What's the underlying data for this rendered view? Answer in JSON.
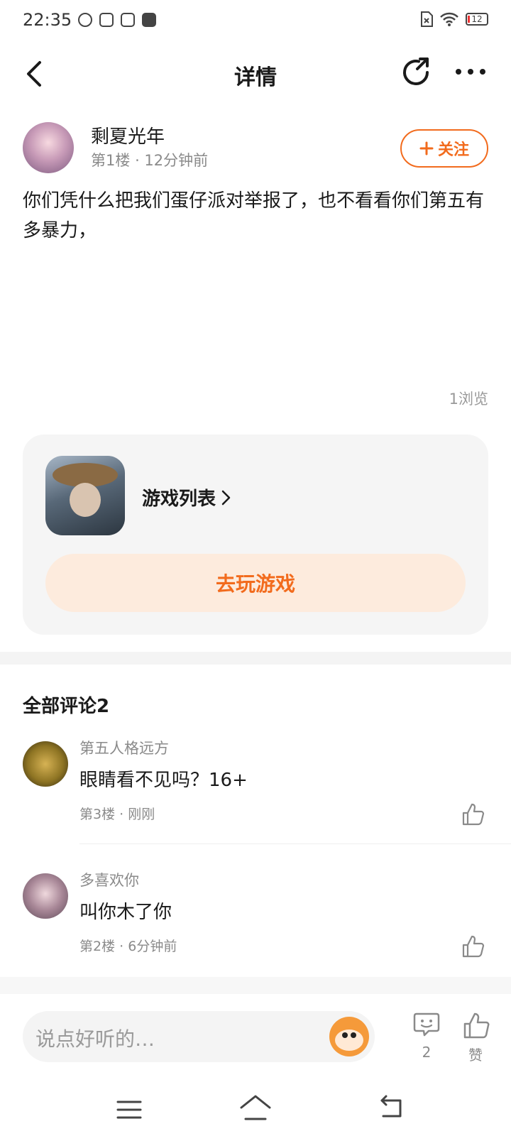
{
  "status_bar": {
    "time": "22:35",
    "battery": "12"
  },
  "header": {
    "title": "详情"
  },
  "post": {
    "author": "剩夏光年",
    "floor": "第1楼",
    "time": "12分钟前",
    "follow_label": "关注",
    "text": "你们凭什么把我们蛋仔派对举报了，也不看看你们第五有多暴力，",
    "views": "1浏览"
  },
  "game_card": {
    "list_label": "游戏列表",
    "play_label": "去玩游戏"
  },
  "comments": {
    "title": "全部评论2",
    "items": [
      {
        "name": "第五人格远方",
        "text": "眼睛看不见吗？16+",
        "floor": "第3楼",
        "time": "刚刚"
      },
      {
        "name": "多喜欢你",
        "text": "叫你木了你",
        "floor": "第2楼",
        "time": "6分钟前"
      }
    ]
  },
  "bottom_bar": {
    "placeholder": "说点好听的…",
    "comment_count": "2",
    "like_label": "赞"
  },
  "colors": {
    "accent": "#f26b1d",
    "play_button_bg": "#fdebdd",
    "card_bg": "#f5f5f5"
  }
}
